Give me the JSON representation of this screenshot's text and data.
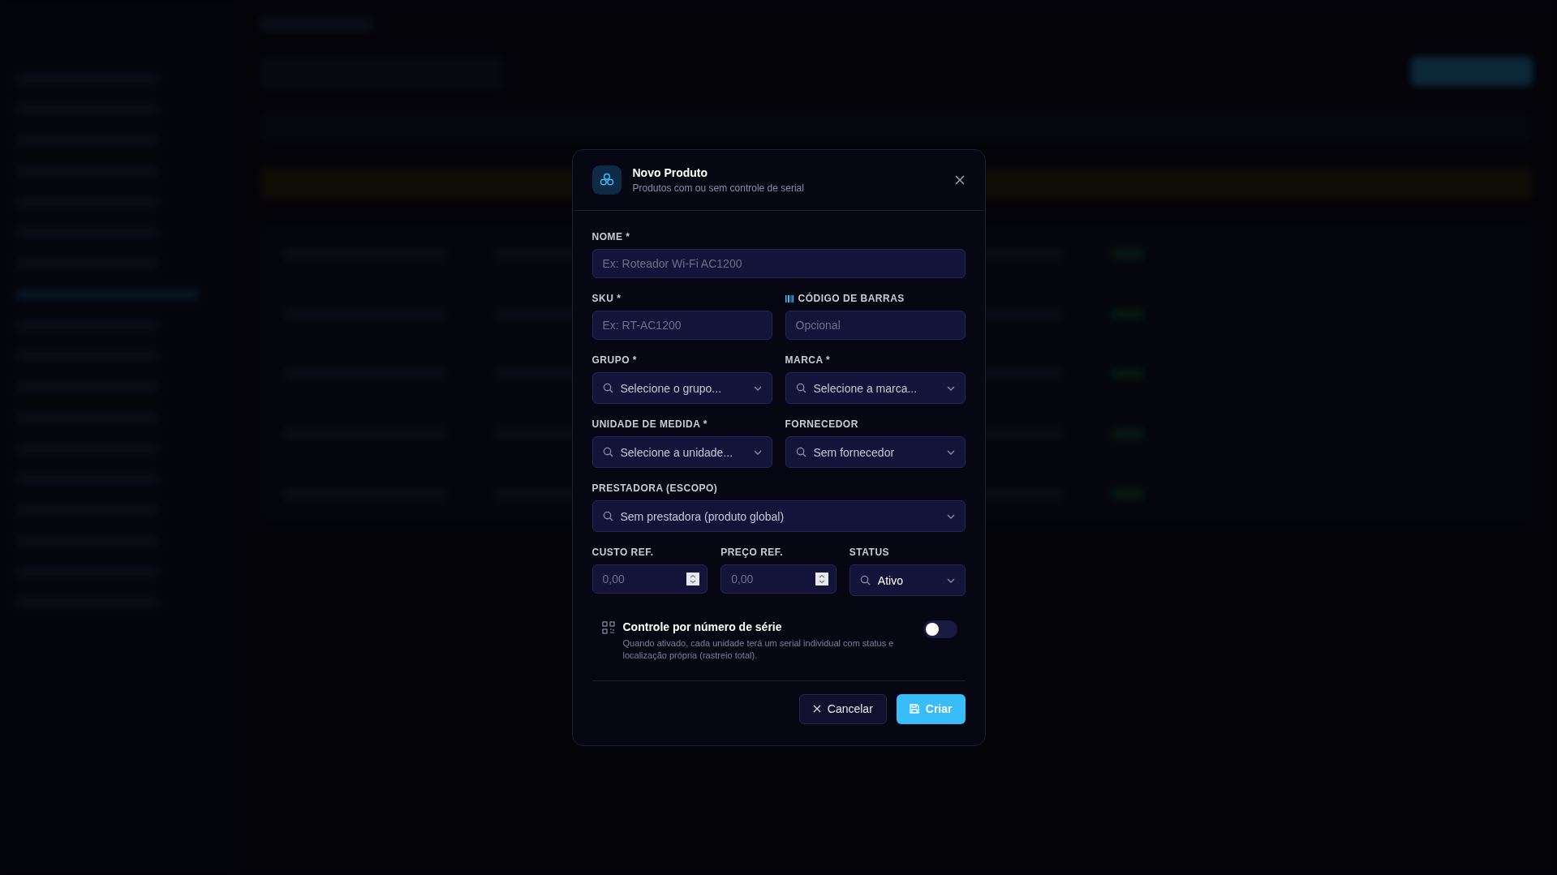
{
  "dialog": {
    "title": "Novo Produto",
    "subtitle": "Produtos com ou sem controle de serial",
    "rows": [
      [
        {
          "kind": "text",
          "label": "NOME *",
          "placeholder": "Ex: Roteador Wi-Fi AC1200"
        }
      ],
      [
        {
          "kind": "text",
          "label": "SKU *",
          "placeholder": "Ex: RT-AC1200"
        },
        {
          "kind": "barcode_text",
          "label": "CÓDIGO DE BARRAS",
          "placeholder": "Opcional"
        }
      ],
      [
        {
          "kind": "select",
          "label": "GRUPO *",
          "placeholder": "Selecione o grupo..."
        },
        {
          "kind": "select",
          "label": "MARCA *",
          "placeholder": "Selecione a marca..."
        }
      ],
      [
        {
          "kind": "select",
          "label": "UNIDADE DE MEDIDA *",
          "placeholder": "Selecione a unidade..."
        },
        {
          "kind": "select",
          "label": "FORNECEDOR",
          "placeholder": "Sem fornecedor"
        }
      ],
      [
        {
          "kind": "select",
          "label": "PRESTADORA (ESCOPO)",
          "placeholder": "Sem prestadora (produto global)"
        }
      ],
      [
        {
          "kind": "number",
          "label": "CUSTO REF.",
          "placeholder": "0,00"
        },
        {
          "kind": "number",
          "label": "PREÇO REF.",
          "placeholder": "0,00"
        },
        {
          "kind": "select",
          "label": "STATUS",
          "value": "Ativo"
        }
      ]
    ],
    "serial_control": {
      "title": "Controle por número de série",
      "description": "Quando ativado, cada unidade terá um serial individual com status e localização própria (rastreio total).",
      "on": false
    },
    "buttons": [
      {
        "kind": "secondary",
        "label": "Cancelar"
      },
      {
        "kind": "primary",
        "label": "Criar"
      }
    ]
  }
}
